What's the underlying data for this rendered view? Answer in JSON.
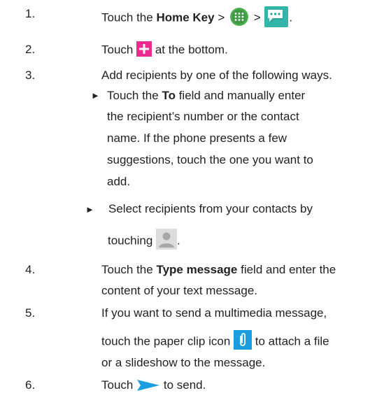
{
  "steps": [
    {
      "number": "1.",
      "lines": [
        {
          "pre": "Touch the ",
          "bold": "Home Key",
          "sep1": " > ",
          "sep2": " > ",
          "end": "."
        }
      ]
    },
    {
      "number": "2.",
      "lines": [
        {
          "pre": "Touch",
          "post": "at the bottom."
        }
      ]
    },
    {
      "number": "3.",
      "lines": [
        {
          "text": "Add recipients by one of the following ways."
        }
      ],
      "bullets": [
        {
          "symbol": "►",
          "lines": [
            {
              "pre": "Touch the ",
              "bold": "To",
              "post": " field and manually enter"
            },
            {
              "text": "the recipient’s number or the contact"
            },
            {
              "text": "name. If the phone presents a few"
            },
            {
              "text": "suggestions, touch the one you want to"
            },
            {
              "text": "add."
            }
          ]
        },
        {
          "symbol": "►",
          "lines": [
            {
              "text": "Select recipients from your contacts by"
            },
            {
              "pre": "touching",
              "end": "."
            }
          ]
        }
      ]
    },
    {
      "number": "4.",
      "lines": [
        {
          "pre": "Touch the ",
          "bold": "Type message",
          "post": " field and enter the"
        },
        {
          "text": "content of your text message."
        }
      ]
    },
    {
      "number": "5.",
      "lines": [
        {
          "text": "If you want to send a multimedia message,"
        },
        {
          "pre": "touch the paper clip icon",
          "post": "to attach a file"
        },
        {
          "text": "or a slideshow to the message."
        }
      ]
    },
    {
      "number": "6.",
      "lines": [
        {
          "pre": "Touch",
          "post": "to send."
        }
      ]
    }
  ],
  "icons": {
    "apps": "apps-grid-icon",
    "messaging": "messaging-app-icon",
    "new_message": "plus-icon",
    "contacts": "contact-person-icon",
    "attach": "paper-clip-icon",
    "send": "send-arrow-icon"
  },
  "colors": {
    "text": "#231f20",
    "apps_icon": "#4caf50",
    "messaging_icon": "#25a59a",
    "plus_icon": "#ec2a8f",
    "contact_icon_bg": "#dcdcdc",
    "attach_icon": "#1a9ee0",
    "send_icon": "#1a9ee0"
  }
}
